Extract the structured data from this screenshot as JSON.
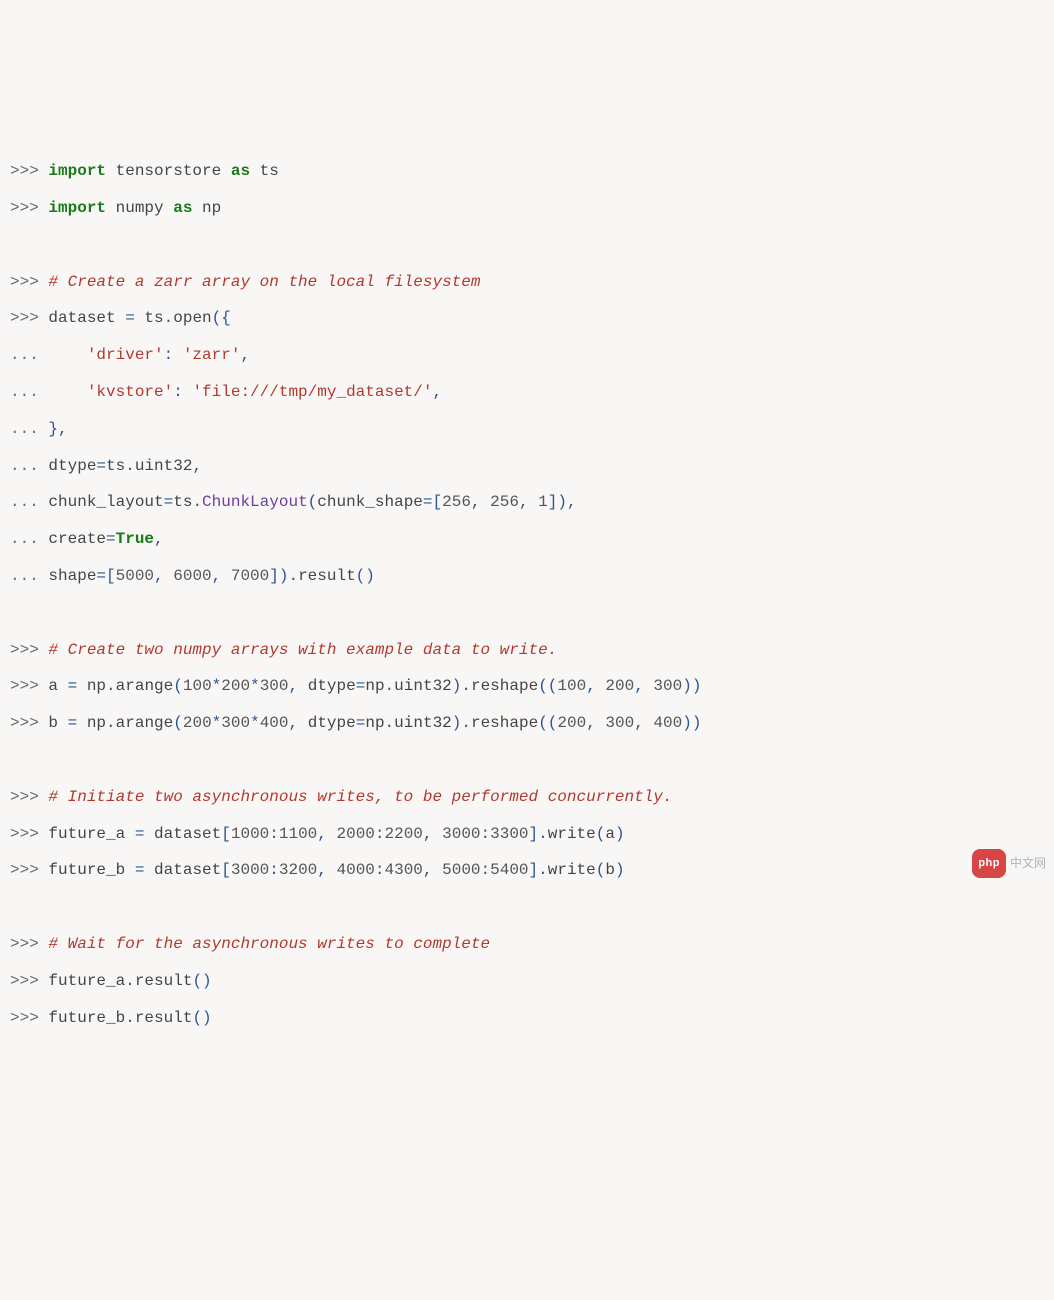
{
  "colors": {
    "background": "#f9f7f6",
    "prompt": "#6b6b6b",
    "keyword": "#1a7a1a",
    "identifier": "#2a5590",
    "plain": "#454545",
    "string": "#b03a2e",
    "comment": "#b03a2e",
    "function": "#6a3fa0"
  },
  "watermark": {
    "pill": "php",
    "text": "中文网"
  },
  "lines": [
    [
      {
        "c": "prompt",
        "t": ">>> "
      },
      {
        "c": "keyword",
        "t": "import"
      },
      {
        "c": "plain",
        "t": " tensorstore "
      },
      {
        "c": "keyword",
        "t": "as"
      },
      {
        "c": "plain",
        "t": " ts"
      }
    ],
    [
      {
        "c": "prompt",
        "t": ">>> "
      },
      {
        "c": "keyword",
        "t": "import"
      },
      {
        "c": "plain",
        "t": " numpy "
      },
      {
        "c": "keyword",
        "t": "as"
      },
      {
        "c": "plain",
        "t": " np"
      }
    ],
    [],
    [
      {
        "c": "prompt",
        "t": ">>> "
      },
      {
        "c": "comment",
        "t": "# Create a zarr array on the local filesystem"
      }
    ],
    [
      {
        "c": "prompt",
        "t": ">>> "
      },
      {
        "c": "plain",
        "t": "dataset "
      },
      {
        "c": "ident",
        "t": "="
      },
      {
        "c": "plain",
        "t": " ts"
      },
      {
        "c": "ident",
        "t": "."
      },
      {
        "c": "plain",
        "t": "open"
      },
      {
        "c": "ident",
        "t": "({"
      }
    ],
    [
      {
        "c": "prompt",
        "t": "... "
      },
      {
        "c": "plain",
        "t": "    "
      },
      {
        "c": "string",
        "t": "'driver'"
      },
      {
        "c": "ident",
        "t": ": "
      },
      {
        "c": "string",
        "t": "'zarr'"
      },
      {
        "c": "ident",
        "t": ","
      }
    ],
    [
      {
        "c": "prompt",
        "t": "... "
      },
      {
        "c": "plain",
        "t": "    "
      },
      {
        "c": "string",
        "t": "'kvstore'"
      },
      {
        "c": "ident",
        "t": ": "
      },
      {
        "c": "string",
        "t": "'file:///tmp/my_dataset/'"
      },
      {
        "c": "ident",
        "t": ","
      }
    ],
    [
      {
        "c": "prompt",
        "t": "... "
      },
      {
        "c": "ident",
        "t": "},"
      }
    ],
    [
      {
        "c": "prompt",
        "t": "... "
      },
      {
        "c": "plain",
        "t": "dtype"
      },
      {
        "c": "ident",
        "t": "="
      },
      {
        "c": "plain",
        "t": "ts"
      },
      {
        "c": "ident",
        "t": "."
      },
      {
        "c": "plain",
        "t": "uint32"
      },
      {
        "c": "ident",
        "t": ","
      }
    ],
    [
      {
        "c": "prompt",
        "t": "... "
      },
      {
        "c": "plain",
        "t": "chunk_layout"
      },
      {
        "c": "ident",
        "t": "="
      },
      {
        "c": "plain",
        "t": "ts"
      },
      {
        "c": "ident",
        "t": "."
      },
      {
        "c": "func",
        "t": "ChunkLayout"
      },
      {
        "c": "ident",
        "t": "("
      },
      {
        "c": "plain",
        "t": "chunk_shape"
      },
      {
        "c": "ident",
        "t": "=["
      },
      {
        "c": "number",
        "t": "256"
      },
      {
        "c": "ident",
        "t": ", "
      },
      {
        "c": "number",
        "t": "256"
      },
      {
        "c": "ident",
        "t": ", "
      },
      {
        "c": "number",
        "t": "1"
      },
      {
        "c": "ident",
        "t": "]),"
      }
    ],
    [
      {
        "c": "prompt",
        "t": "... "
      },
      {
        "c": "plain",
        "t": "create"
      },
      {
        "c": "ident",
        "t": "="
      },
      {
        "c": "const",
        "t": "True"
      },
      {
        "c": "ident",
        "t": ","
      }
    ],
    [
      {
        "c": "prompt",
        "t": "... "
      },
      {
        "c": "plain",
        "t": "shape"
      },
      {
        "c": "ident",
        "t": "=["
      },
      {
        "c": "number",
        "t": "5000"
      },
      {
        "c": "ident",
        "t": ", "
      },
      {
        "c": "number",
        "t": "6000"
      },
      {
        "c": "ident",
        "t": ", "
      },
      {
        "c": "number",
        "t": "7000"
      },
      {
        "c": "ident",
        "t": "])."
      },
      {
        "c": "plain",
        "t": "result"
      },
      {
        "c": "ident",
        "t": "()"
      }
    ],
    [],
    [
      {
        "c": "prompt",
        "t": ">>> "
      },
      {
        "c": "comment",
        "t": "# Create two numpy arrays with example data to write."
      }
    ],
    [
      {
        "c": "prompt",
        "t": ">>> "
      },
      {
        "c": "plain",
        "t": "a "
      },
      {
        "c": "ident",
        "t": "="
      },
      {
        "c": "plain",
        "t": " np"
      },
      {
        "c": "ident",
        "t": "."
      },
      {
        "c": "plain",
        "t": "arange"
      },
      {
        "c": "ident",
        "t": "("
      },
      {
        "c": "number",
        "t": "100"
      },
      {
        "c": "ident",
        "t": "*"
      },
      {
        "c": "number",
        "t": "200"
      },
      {
        "c": "ident",
        "t": "*"
      },
      {
        "c": "number",
        "t": "300"
      },
      {
        "c": "ident",
        "t": ", "
      },
      {
        "c": "plain",
        "t": "dtype"
      },
      {
        "c": "ident",
        "t": "="
      },
      {
        "c": "plain",
        "t": "np"
      },
      {
        "c": "ident",
        "t": "."
      },
      {
        "c": "plain",
        "t": "uint32"
      },
      {
        "c": "ident",
        "t": ")."
      },
      {
        "c": "plain",
        "t": "reshape"
      },
      {
        "c": "ident",
        "t": "(("
      },
      {
        "c": "number",
        "t": "100"
      },
      {
        "c": "ident",
        "t": ", "
      },
      {
        "c": "number",
        "t": "200"
      },
      {
        "c": "ident",
        "t": ", "
      },
      {
        "c": "number",
        "t": "300"
      },
      {
        "c": "ident",
        "t": "))"
      }
    ],
    [
      {
        "c": "prompt",
        "t": ">>> "
      },
      {
        "c": "plain",
        "t": "b "
      },
      {
        "c": "ident",
        "t": "="
      },
      {
        "c": "plain",
        "t": " np"
      },
      {
        "c": "ident",
        "t": "."
      },
      {
        "c": "plain",
        "t": "arange"
      },
      {
        "c": "ident",
        "t": "("
      },
      {
        "c": "number",
        "t": "200"
      },
      {
        "c": "ident",
        "t": "*"
      },
      {
        "c": "number",
        "t": "300"
      },
      {
        "c": "ident",
        "t": "*"
      },
      {
        "c": "number",
        "t": "400"
      },
      {
        "c": "ident",
        "t": ", "
      },
      {
        "c": "plain",
        "t": "dtype"
      },
      {
        "c": "ident",
        "t": "="
      },
      {
        "c": "plain",
        "t": "np"
      },
      {
        "c": "ident",
        "t": "."
      },
      {
        "c": "plain",
        "t": "uint32"
      },
      {
        "c": "ident",
        "t": ")."
      },
      {
        "c": "plain",
        "t": "reshape"
      },
      {
        "c": "ident",
        "t": "(("
      },
      {
        "c": "number",
        "t": "200"
      },
      {
        "c": "ident",
        "t": ", "
      },
      {
        "c": "number",
        "t": "300"
      },
      {
        "c": "ident",
        "t": ", "
      },
      {
        "c": "number",
        "t": "400"
      },
      {
        "c": "ident",
        "t": "))"
      }
    ],
    [],
    [
      {
        "c": "prompt",
        "t": ">>> "
      },
      {
        "c": "comment",
        "t": "# Initiate two asynchronous writes, to be performed concurrently."
      }
    ],
    [
      {
        "c": "prompt",
        "t": ">>> "
      },
      {
        "c": "plain",
        "t": "future_a "
      },
      {
        "c": "ident",
        "t": "="
      },
      {
        "c": "plain",
        "t": " dataset"
      },
      {
        "c": "ident",
        "t": "["
      },
      {
        "c": "number",
        "t": "1000"
      },
      {
        "c": "ident",
        "t": ":"
      },
      {
        "c": "number",
        "t": "1100"
      },
      {
        "c": "ident",
        "t": ", "
      },
      {
        "c": "number",
        "t": "2000"
      },
      {
        "c": "ident",
        "t": ":"
      },
      {
        "c": "number",
        "t": "2200"
      },
      {
        "c": "ident",
        "t": ", "
      },
      {
        "c": "number",
        "t": "3000"
      },
      {
        "c": "ident",
        "t": ":"
      },
      {
        "c": "number",
        "t": "3300"
      },
      {
        "c": "ident",
        "t": "]."
      },
      {
        "c": "plain",
        "t": "write"
      },
      {
        "c": "ident",
        "t": "("
      },
      {
        "c": "plain",
        "t": "a"
      },
      {
        "c": "ident",
        "t": ")"
      }
    ],
    [
      {
        "c": "prompt",
        "t": ">>> "
      },
      {
        "c": "plain",
        "t": "future_b "
      },
      {
        "c": "ident",
        "t": "="
      },
      {
        "c": "plain",
        "t": " dataset"
      },
      {
        "c": "ident",
        "t": "["
      },
      {
        "c": "number",
        "t": "3000"
      },
      {
        "c": "ident",
        "t": ":"
      },
      {
        "c": "number",
        "t": "3200"
      },
      {
        "c": "ident",
        "t": ", "
      },
      {
        "c": "number",
        "t": "4000"
      },
      {
        "c": "ident",
        "t": ":"
      },
      {
        "c": "number",
        "t": "4300"
      },
      {
        "c": "ident",
        "t": ", "
      },
      {
        "c": "number",
        "t": "5000"
      },
      {
        "c": "ident",
        "t": ":"
      },
      {
        "c": "number",
        "t": "5400"
      },
      {
        "c": "ident",
        "t": "]."
      },
      {
        "c": "plain",
        "t": "write"
      },
      {
        "c": "ident",
        "t": "("
      },
      {
        "c": "plain",
        "t": "b"
      },
      {
        "c": "ident",
        "t": ")"
      }
    ],
    [],
    [
      {
        "c": "prompt",
        "t": ">>> "
      },
      {
        "c": "comment",
        "t": "# Wait for the asynchronous writes to complete"
      }
    ],
    [
      {
        "c": "prompt",
        "t": ">>> "
      },
      {
        "c": "plain",
        "t": "future_a"
      },
      {
        "c": "ident",
        "t": "."
      },
      {
        "c": "plain",
        "t": "result"
      },
      {
        "c": "ident",
        "t": "()"
      }
    ],
    [
      {
        "c": "prompt",
        "t": ">>> "
      },
      {
        "c": "plain",
        "t": "future_b"
      },
      {
        "c": "ident",
        "t": "."
      },
      {
        "c": "plain",
        "t": "result"
      },
      {
        "c": "ident",
        "t": "()"
      }
    ]
  ]
}
